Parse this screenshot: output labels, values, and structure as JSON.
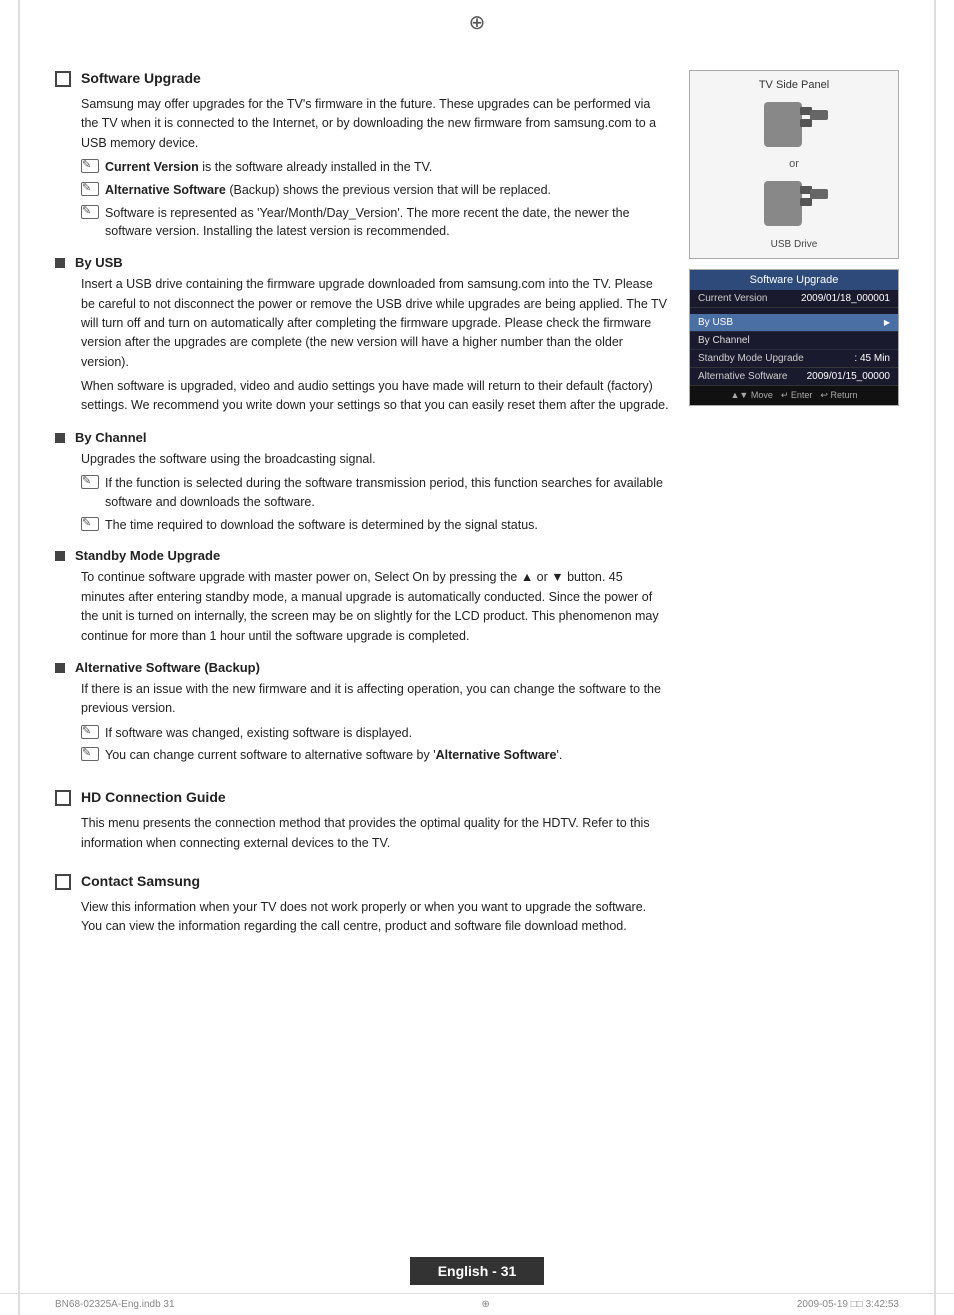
{
  "page": {
    "top_compass": "⊕",
    "bottom_compass": "⊕",
    "page_number": "English - 31",
    "footer_left": "BN68-02325A-Eng.indb   31",
    "footer_right": "2009-05-19   □□ 3:42:53"
  },
  "tv_panel": {
    "label": "TV Side Panel",
    "or_text": "or",
    "usb_label": "USB Drive"
  },
  "sw_upgrade_ui": {
    "title": "Software Upgrade",
    "current_version_label": "Current Version",
    "current_version_value": "2009/01/18_000001",
    "by_usb": "By USB",
    "by_channel": "By Channel",
    "standby_mode_label": "Standby Mode Upgrade",
    "standby_mode_value": ": 45 Min",
    "alt_software_label": "Alternative Software",
    "alt_software_value": "2009/01/15_00000",
    "footer_move": "▲▼ Move",
    "footer_enter": "↵ Enter",
    "footer_return": "↩ Return"
  },
  "sections": [
    {
      "type": "checkbox",
      "title": "Software Upgrade",
      "body": "Samsung may offer upgrades for the TV's firmware in the future. These upgrades can be performed via the TV when it is connected to the Internet, or by downloading the new firmware from samsung.com to a USB memory device.",
      "notes": [
        {
          "bold": "Current Version",
          "text": " is the software already installed in the TV."
        },
        {
          "bold": "Alternative Software",
          "text": " (Backup) shows the previous version that will be replaced."
        },
        {
          "text": "Software is represented as 'Year/Month/Day_Version'. The more recent the date, the newer the software version. Installing the latest version is recommended."
        }
      ],
      "subsections": [
        {
          "title": "By USB",
          "body": "Insert a USB drive containing the firmware upgrade downloaded from samsung.com into the TV. Please be careful to not disconnect the power or remove the USB drive while upgrades are being applied. The TV will turn off and turn on automatically after completing the firmware upgrade. Please check the firmware version after the upgrades are complete (the new version will have a higher number than the older version).",
          "body2": "When software is upgraded, video and audio settings you have made will return to their default (factory) settings. We recommend you write down your settings so that you can easily reset them after the upgrade."
        },
        {
          "title": "By Channel",
          "body": "Upgrades the software using the broadcasting signal.",
          "notes": [
            {
              "text": "If the function is selected during the software transmission period, this function searches for available software and downloads the software."
            },
            {
              "text": "The time required to download the software is determined by the signal status."
            }
          ]
        },
        {
          "title": "Standby Mode Upgrade",
          "body": "To continue software upgrade with master power on, Select On by pressing the ▲ or ▼ button. 45 minutes after entering standby mode, a manual upgrade is automatically conducted. Since the power of the unit is turned on internally, the screen may be on slightly for the LCD product. This phenomenon may continue for more than 1 hour until the software upgrade is completed."
        },
        {
          "title": "Alternative Software (Backup)",
          "body": "If there is an issue with the new firmware and it is affecting operation, you can change the software to the previous version.",
          "notes": [
            {
              "text": "If software was changed, existing software is displayed."
            },
            {
              "text": "You can change current software to alternative software by '",
              "bold_end": "Alternative Software",
              "text_after": "'."
            }
          ]
        }
      ]
    },
    {
      "type": "checkbox",
      "title": "HD Connection Guide",
      "body": "This menu presents the connection method that provides the optimal quality for the HDTV. Refer to this information when connecting external devices to the TV."
    },
    {
      "type": "checkbox",
      "title": "Contact Samsung",
      "body": "View this information when your TV does not work properly or when you want to upgrade the software. You can view the information regarding the call centre, product and software file download method."
    }
  ]
}
